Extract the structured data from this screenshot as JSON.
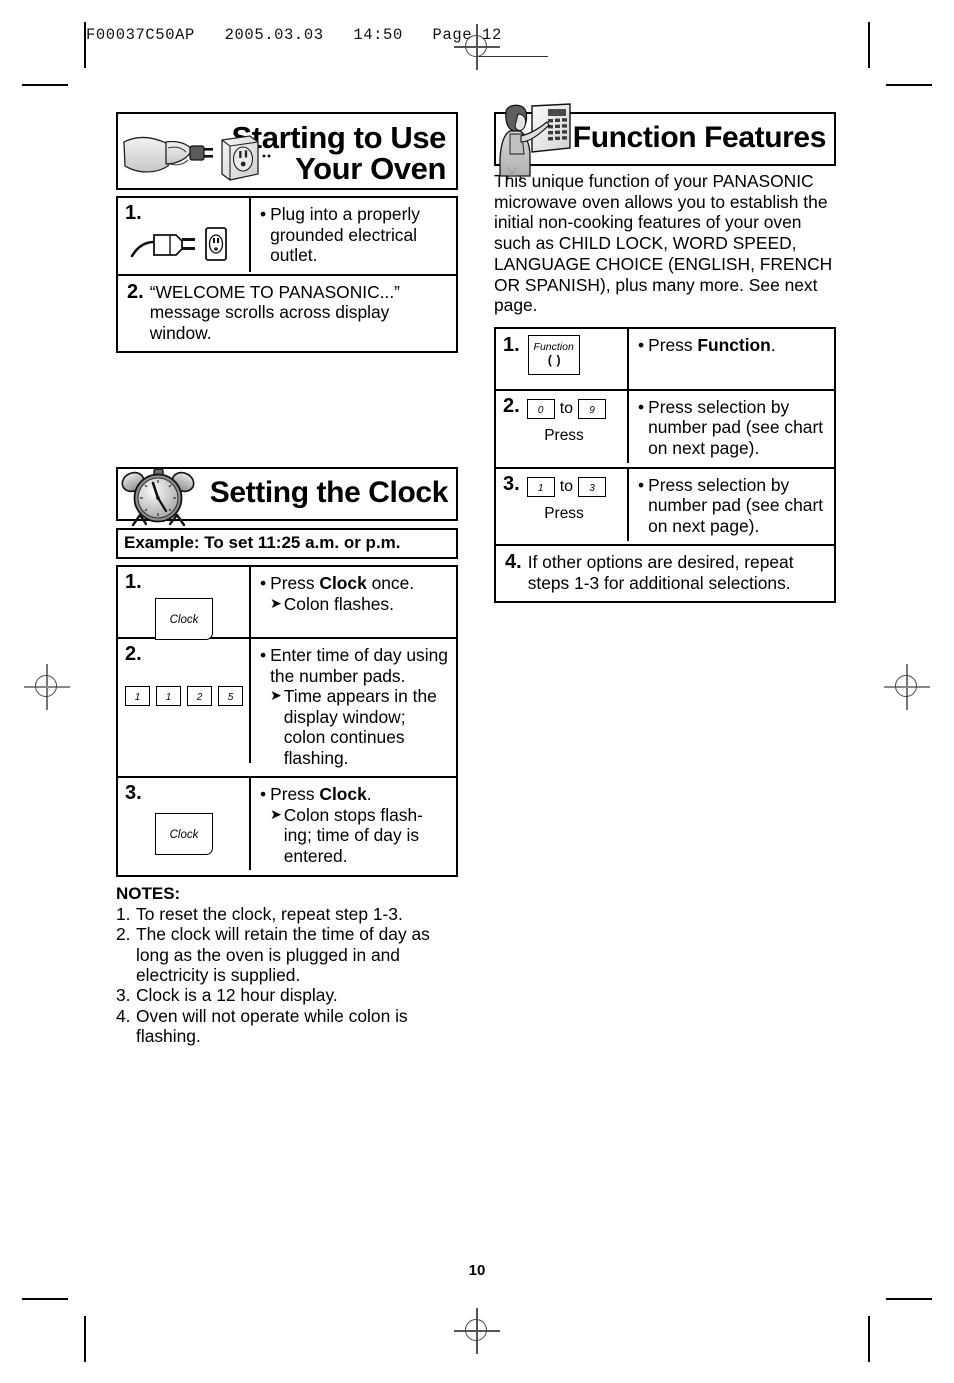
{
  "print_slug": "F00037C50AP   2005.03.03   14:50   Page 12",
  "page_number": "10",
  "left_column": {
    "banner": {
      "title_line1": "Starting to Use",
      "title_line2": "Your Oven",
      "icon": "hand-plug-outlet-icon",
      "dots": "....."
    },
    "steps": [
      {
        "number": "1.",
        "icon": "plug-outlet-icon",
        "bullet": "•",
        "text": "Plug into a properly grounded electrical outlet."
      },
      {
        "number": "2.",
        "text": "“WELCOME TO PANASONIC...” message scrolls across display window.",
        "full_width": true
      }
    ],
    "clock_banner": {
      "title": "Setting the Clock",
      "icon": "alarm-clock-icon"
    },
    "example_label": "Example: To set 11:25 a.m. or p.m.",
    "clock_steps": [
      {
        "number": "1.",
        "key_label": "Clock",
        "bullet": "•",
        "text_pre": "Press ",
        "text_bold": "Clock",
        "text_post": " once.",
        "sub_arrow": "➤",
        "sub_text": "Colon flashes."
      },
      {
        "number": "2.",
        "keys": [
          "1",
          "1",
          "2",
          "5"
        ],
        "bullet": "•",
        "text": "Enter time of day using the number pads.",
        "sub_arrow": "➤",
        "sub_text": "Time appears in the display window; colon continues flashing."
      },
      {
        "number": "3.",
        "key_label": "Clock",
        "bullet": "•",
        "text_pre": "Press ",
        "text_bold": "Clock",
        "text_post": ".",
        "sub_arrow": "➤",
        "sub_text": "Colon stops flash-ing; time of day is entered."
      }
    ],
    "notes": {
      "heading": "NOTES:",
      "items": [
        {
          "index": "1.",
          "text": "To reset the clock, repeat step 1-3."
        },
        {
          "index": "2.",
          "text": "The clock will retain the time of day as long as the oven is plugged in and electricity is supplied."
        },
        {
          "index": "3.",
          "text": "Clock is a 12 hour display."
        },
        {
          "index": "4.",
          "text": "Oven will not operate while colon is flashing."
        }
      ]
    }
  },
  "right_column": {
    "banner": {
      "title": "Function Features",
      "icon": "woman-pressing-control-panel-icon"
    },
    "intro": "This unique function of your PANASONIC microwave oven allows you to establish the initial non-cooking features of your oven such as CHILD LOCK, WORD SPEED, LANGUAGE CHOICE (ENGLISH, FRENCH OR SPANISH), plus many more. See next page.",
    "steps": [
      {
        "number": "1.",
        "key_label": "Function",
        "key_symbol": "( )",
        "bullet": "•",
        "text_pre": "Press ",
        "text_bold": "Function",
        "text_post": "."
      },
      {
        "number": "2.",
        "key_from": "0",
        "key_to": "9",
        "to_word": "to",
        "press_label": "Press",
        "bullet": "•",
        "text": "Press selection by number pad (see chart on next page)."
      },
      {
        "number": "3.",
        "key_from": "1",
        "key_to": "3",
        "to_word": "to",
        "press_label": "Press",
        "bullet": "•",
        "text": "Press selection by number pad (see chart on next page)."
      },
      {
        "number": "4.",
        "text": "If other options are desired, repeat steps 1-3 for additional selections.",
        "full_width": true
      }
    ]
  }
}
